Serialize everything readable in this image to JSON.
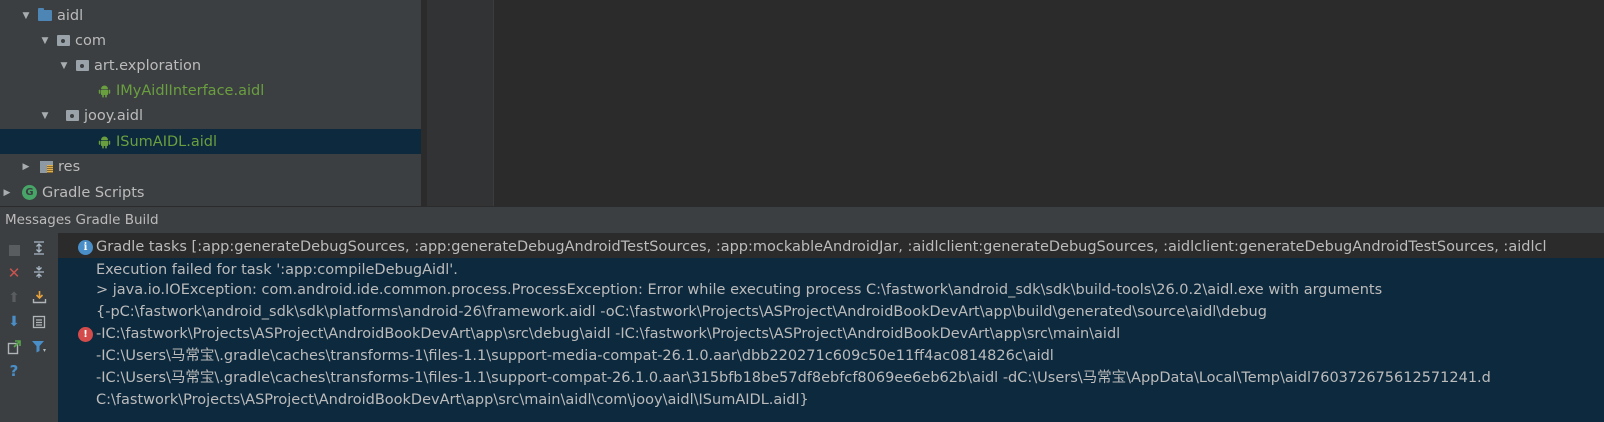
{
  "project_tree": {
    "items": [
      {
        "label": "aidl",
        "expanded": true,
        "icon": "folder-blue-icon"
      },
      {
        "label": "com",
        "expanded": true,
        "icon": "package-icon"
      },
      {
        "label": "art.exploration",
        "expanded": true,
        "icon": "package-icon"
      },
      {
        "label": "IMyAidlInterface.aidl",
        "icon": "android-file-icon"
      },
      {
        "label": "jooy.aidl",
        "expanded": true,
        "icon": "package-icon"
      },
      {
        "label": "ISumAIDL.aidl",
        "icon": "android-file-icon",
        "selected": true
      },
      {
        "label": "res",
        "expanded": false,
        "icon": "res-folder-icon"
      },
      {
        "label": "Gradle Scripts",
        "expanded": false,
        "icon": "gradle-icon"
      }
    ]
  },
  "tool_window": {
    "title": "Messages Gradle Build"
  },
  "messages": {
    "info": {
      "text": "Gradle tasks [:app:generateDebugSources, :app:generateDebugAndroidTestSources, :app:mockableAndroidJar, :aidlclient:generateDebugSources, :aidlclient:generateDebugAndroidTestSources, :aidlcl"
    },
    "error": {
      "lines": [
        "Execution failed for task ':app:compileDebugAidl'.",
        "> java.io.IOException: com.android.ide.common.process.ProcessException: Error while executing process C:\\fastwork\\android_sdk\\sdk\\build-tools\\26.0.2\\aidl.exe with arguments",
        "{-pC:\\fastwork\\android_sdk\\sdk\\platforms\\android-26\\framework.aidl -oC:\\fastwork\\Projects\\ASProject\\AndroidBookDevArt\\app\\build\\generated\\source\\aidl\\debug",
        "-IC:\\fastwork\\Projects\\ASProject\\AndroidBookDevArt\\app\\src\\debug\\aidl -IC:\\fastwork\\Projects\\ASProject\\AndroidBookDevArt\\app\\src\\main\\aidl",
        "-IC:\\Users\\马常宝\\.gradle\\caches\\transforms-1\\files-1.1\\support-media-compat-26.1.0.aar\\dbb220271c609c50e11ff4ac0814826c\\aidl",
        "-IC:\\Users\\马常宝\\.gradle\\caches\\transforms-1\\files-1.1\\support-compat-26.1.0.aar\\315bfb18be57df8ebfcf8069ee6eb62b\\aidl -dC:\\Users\\马常宝\\AppData\\Local\\Temp\\aidl760372675612571241.d",
        "C:\\fastwork\\Projects\\ASProject\\AndroidBookDevArt\\app\\src\\main\\aidl\\com\\jooy\\aidl\\ISumAIDL.aidl}"
      ]
    }
  },
  "side_toolbar": {
    "buttons": [
      "stop-icon",
      "close-icon",
      "up-icon",
      "down-icon",
      "export-icon",
      "help-icon",
      "expand-all-icon",
      "collapse-all-icon",
      "download-icon",
      "layout-icon",
      "filter-icon"
    ]
  },
  "colors": {
    "tree_bg": "#3c3f41",
    "editor_bg": "#2b2b2b",
    "selection": "#0d293e",
    "android_green": "#6a9f3f",
    "error_red": "#d44b4b",
    "info_blue": "#4a8ec7"
  }
}
